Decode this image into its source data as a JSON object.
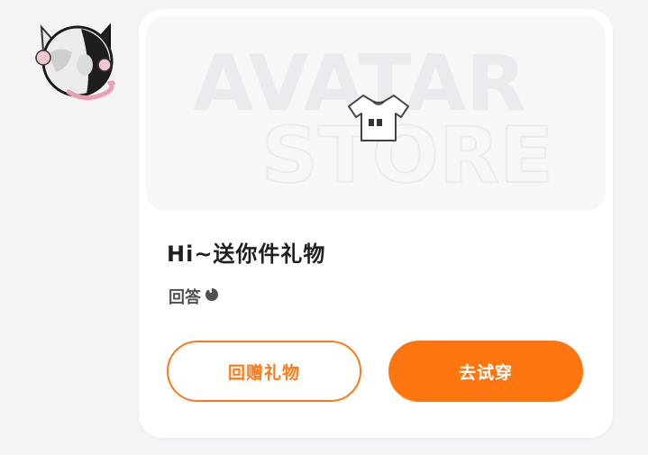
{
  "card": {
    "banner_watermark_line1": "AVATAR",
    "banner_watermark_line2": "STORE",
    "title": "Hi~送你件礼物",
    "reply_label": "回答"
  },
  "buttons": {
    "return_gift": "回赠礼物",
    "try_on": "去试穿"
  },
  "colors": {
    "accent": "#ff7611",
    "background": "#f4f4f6",
    "card": "#ffffff"
  }
}
